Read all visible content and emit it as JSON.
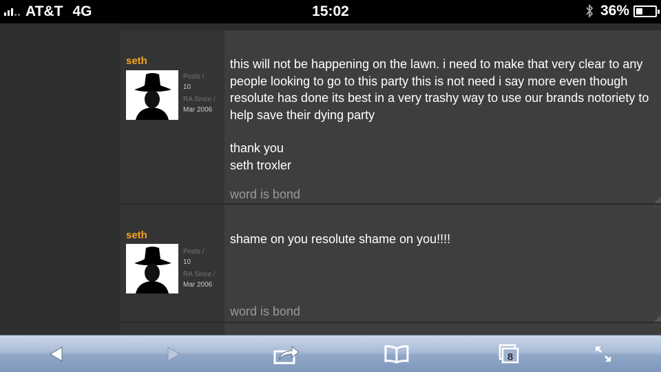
{
  "status": {
    "carrier": "AT&T",
    "network": "4G",
    "time": "15:02",
    "battery": "36%",
    "battery_level": 0.36,
    "signal_bars": 3
  },
  "posts": [
    {
      "username": "seth",
      "posts_label": "Posts /",
      "posts_value": "10",
      "since_label": "RA Since /",
      "since_value": "Mar 2006",
      "paragraphs": [
        "this will not be happening on the lawn. i need to make that very clear to any people looking to go to this party this is not need i say more even though resolute has done its best in a very trashy way to use our brands notoriety to help save their dying party",
        "thank you\nseth troxler"
      ],
      "signature": "word is bond"
    },
    {
      "username": "seth",
      "posts_label": "Posts /",
      "posts_value": "10",
      "since_label": "RA Since /",
      "since_value": "Mar 2006",
      "paragraphs": [
        "shame on you resolute shame on you!!!!"
      ],
      "signature": "word is bond"
    }
  ],
  "toolbar": {
    "tabs_count": "8",
    "icons": [
      "back-icon",
      "forward-icon",
      "share-icon",
      "bookmarks-icon",
      "tabs-icon",
      "fullscreen-icon"
    ]
  },
  "colors": {
    "username": "#f5a623",
    "post_bg": "#3e3e3e",
    "toolbar": "#9fb3d1"
  }
}
